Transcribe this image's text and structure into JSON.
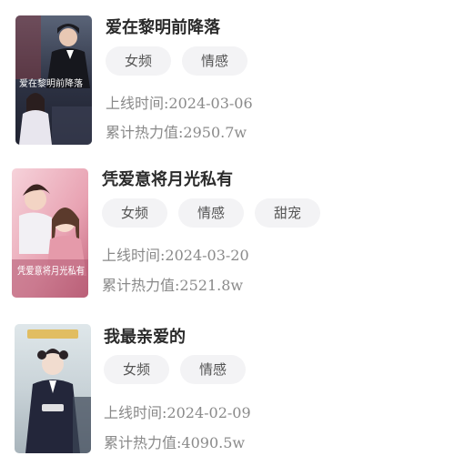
{
  "dramas": [
    {
      "title": "爱在黎明前降落",
      "poster_text": "爱在黎明前降落",
      "poster_icon": "drama-poster-image",
      "tags": [
        "女频",
        "情感"
      ],
      "release_label": "上线时间:",
      "release_date": "2024-03-06",
      "heat_label": "累计热力值:",
      "heat_value": "2950.7w"
    },
    {
      "title": "凭爱意将月光私有",
      "poster_text": "凭爱意将月光私有",
      "poster_icon": "drama-poster-image",
      "tags": [
        "女频",
        "情感",
        "甜宠"
      ],
      "release_label": "上线时间:",
      "release_date": "2024-03-20",
      "heat_label": "累计热力值:",
      "heat_value": "2521.8w"
    },
    {
      "title": "我最亲爱的",
      "poster_text": "",
      "poster_icon": "drama-poster-image",
      "tags": [
        "女频",
        "情感"
      ],
      "release_label": "上线时间:",
      "release_date": "2024-02-09",
      "heat_label": "累计热力值:",
      "heat_value": "4090.5w"
    }
  ]
}
